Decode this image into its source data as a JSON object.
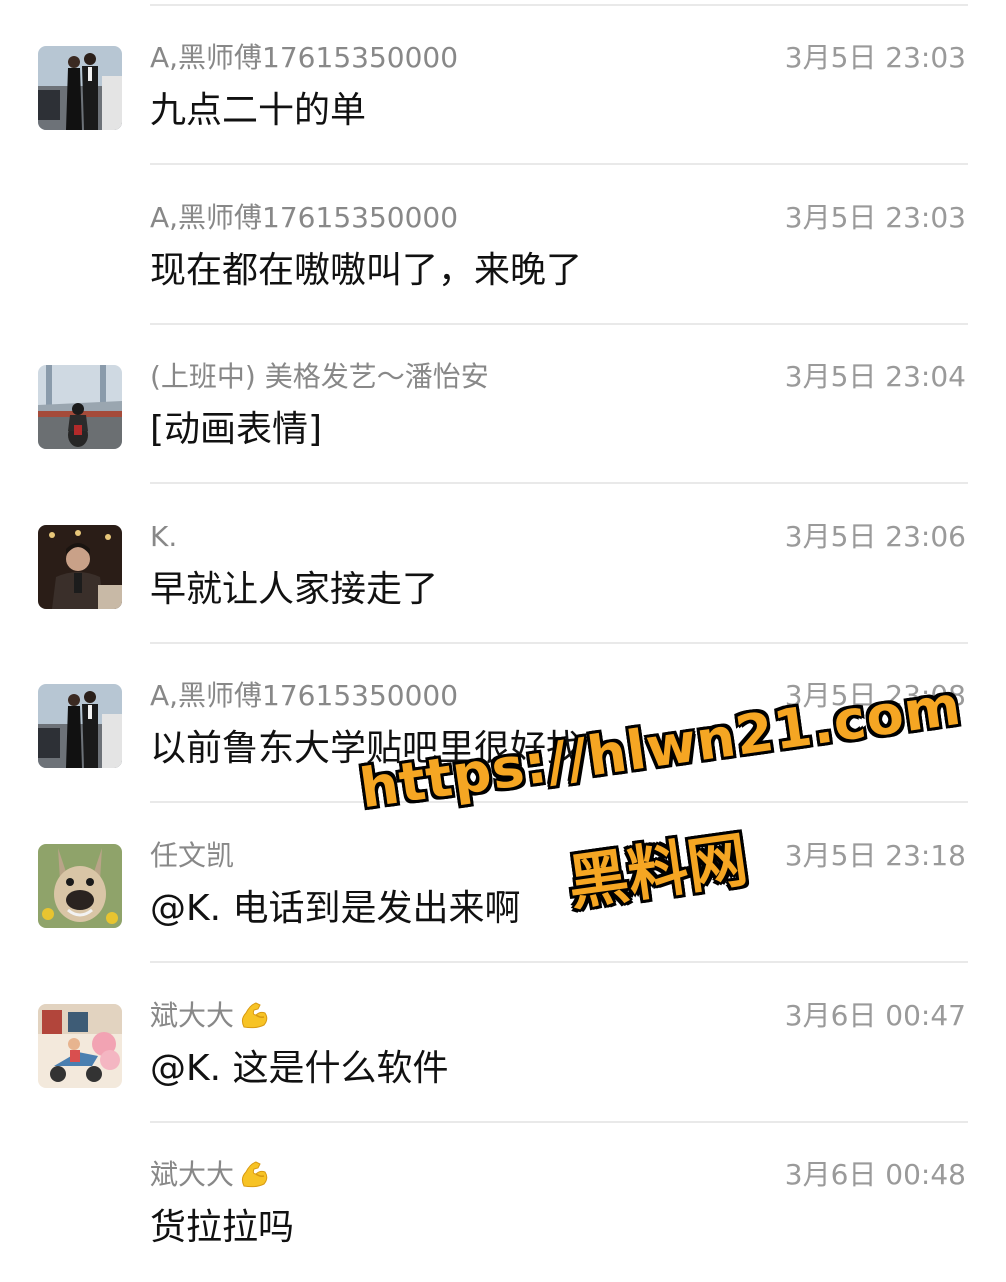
{
  "messages": [
    {
      "sender": "A,黑师傅17615350000",
      "time": "3月5日 23:03",
      "text": "九点二十的单",
      "avatar": "couple-photo-avatar",
      "show_avatar": true
    },
    {
      "sender": "A,黑师傅17615350000",
      "time": "3月5日 23:03",
      "text": "现在都在嗷嗷叫了，来晚了",
      "avatar": "couple-photo-avatar",
      "show_avatar": false
    },
    {
      "sender": "(上班中) 美格发艺～潘怡安",
      "time": "3月5日 23:04",
      "text": "[动画表情]",
      "avatar": "motorcycle-bridge-avatar",
      "show_avatar": true
    },
    {
      "sender": "K.",
      "time": "3月5日 23:06",
      "text": "早就让人家接走了",
      "avatar": "man-portrait-avatar",
      "show_avatar": true
    },
    {
      "sender": "A,黑师傅17615350000",
      "time": "3月5日 23:08",
      "text": "以前鲁东大学贴吧里很好找",
      "avatar": "couple-photo-avatar",
      "show_avatar": true
    },
    {
      "sender": "任文凯",
      "time": "3月5日 23:18",
      "text": "@K. 电话到是发出来啊",
      "avatar": "dog-face-avatar",
      "show_avatar": true
    },
    {
      "sender": "斌大大",
      "time": "3月6日 00:47",
      "text": "@K. 这是什么软件",
      "avatar": "delivery-scooter-avatar",
      "show_avatar": true,
      "emoji": "flexed-biceps-icon"
    },
    {
      "sender": "斌大大",
      "time": "3月6日 00:48",
      "text": "货拉拉吗",
      "avatar": "delivery-scooter-avatar",
      "show_avatar": false,
      "emoji": "flexed-biceps-icon"
    }
  ],
  "watermark": {
    "url": "https://hlwn21.com",
    "name": "黑料网",
    "color": "#f5a623"
  }
}
